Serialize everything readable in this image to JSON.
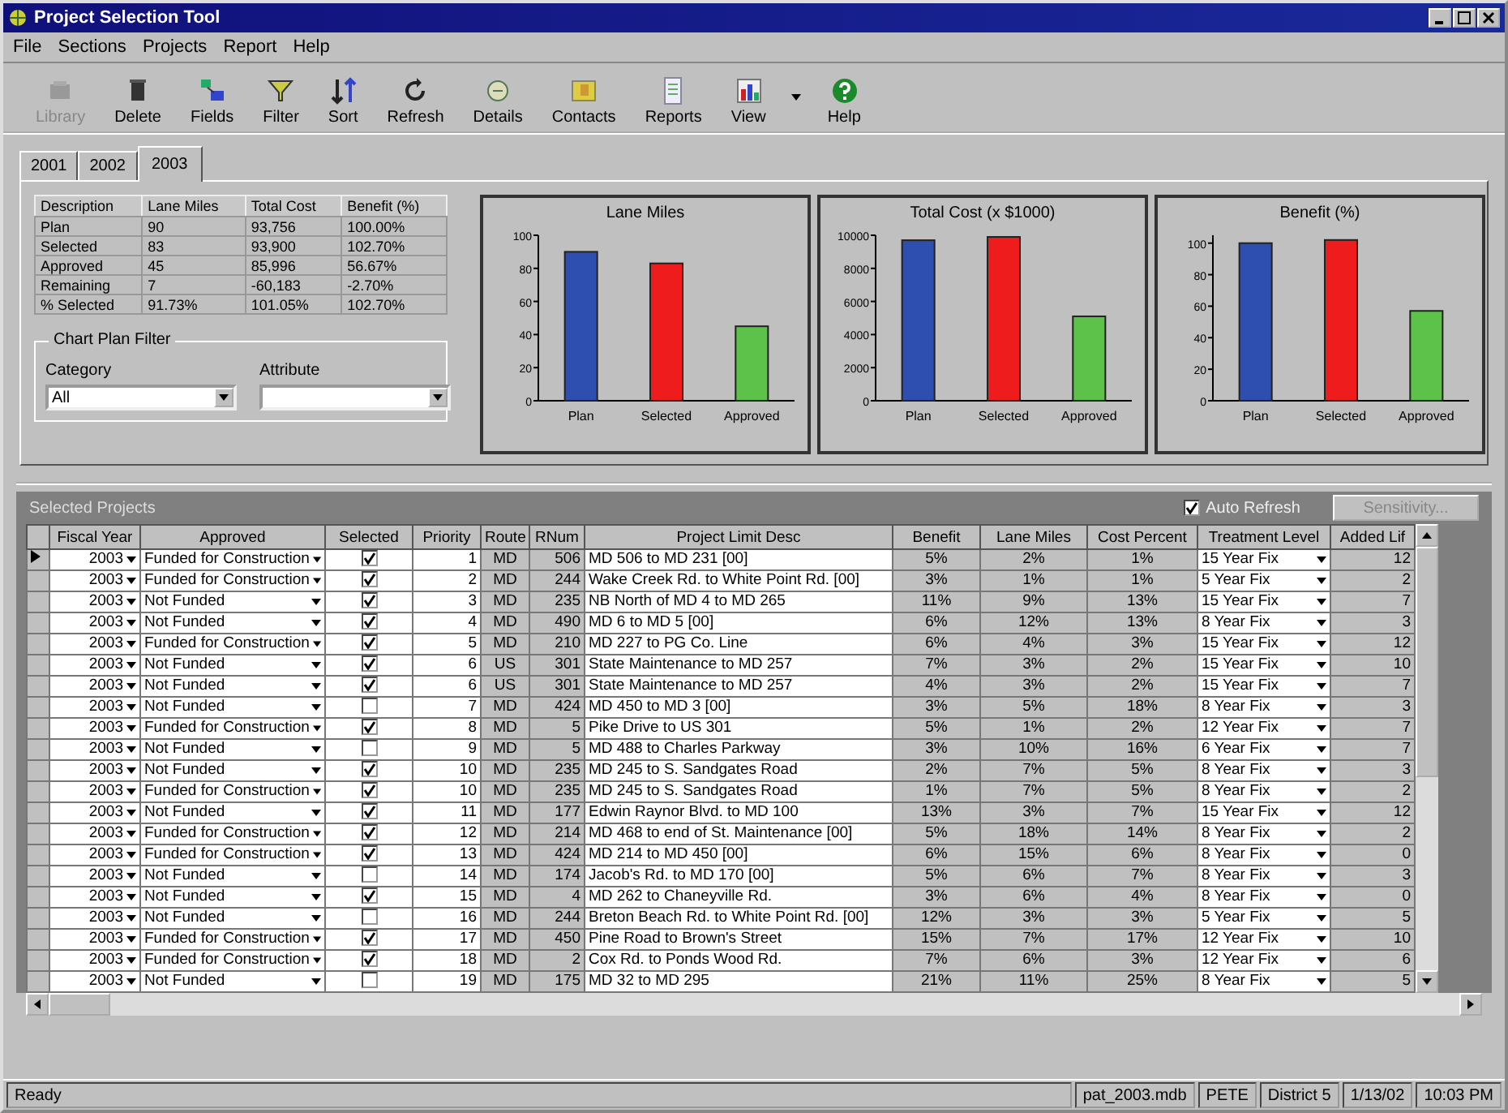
{
  "window": {
    "title": "Project Selection Tool"
  },
  "menu": [
    "File",
    "Sections",
    "Projects",
    "Report",
    "Help"
  ],
  "toolbar": [
    {
      "label": "Library",
      "kind": "library",
      "disabled": true
    },
    {
      "label": "Delete",
      "kind": "delete",
      "disabled": false
    },
    {
      "label": "Fields",
      "kind": "fields",
      "disabled": false
    },
    {
      "label": "Filter",
      "kind": "filter",
      "disabled": false
    },
    {
      "label": "Sort",
      "kind": "sort",
      "disabled": false
    },
    {
      "label": "Refresh",
      "kind": "refresh",
      "disabled": false
    },
    {
      "label": "Details",
      "kind": "details",
      "disabled": false
    },
    {
      "label": "Contacts",
      "kind": "contacts",
      "disabled": false
    },
    {
      "label": "Reports",
      "kind": "reports",
      "disabled": false
    },
    {
      "label": "View",
      "kind": "view",
      "disabled": false
    },
    {
      "label": "Help",
      "kind": "help",
      "disabled": false
    }
  ],
  "tabs": [
    {
      "label": "2001",
      "selected": false
    },
    {
      "label": "2002",
      "selected": false
    },
    {
      "label": "2003",
      "selected": true
    }
  ],
  "summary": {
    "columns": [
      "Description",
      "Lane Miles",
      "Total Cost",
      "Benefit (%)"
    ],
    "rows": [
      [
        "Plan",
        "90",
        "93,756",
        "100.00%"
      ],
      [
        "Selected",
        "83",
        "93,900",
        "102.70%"
      ],
      [
        "Approved",
        "45",
        "85,996",
        "56.67%"
      ],
      [
        "Remaining",
        "7",
        "-60,183",
        "-2.70%"
      ],
      [
        "% Selected",
        "91.73%",
        "101.05%",
        "102.70%"
      ]
    ]
  },
  "chart_plan_filter": {
    "title": "Chart Plan Filter",
    "category": {
      "label": "Category",
      "value": "All"
    },
    "attribute": {
      "label": "Attribute"
    }
  },
  "charts": [
    {
      "chart_data": {
        "type": "bar",
        "title": "Lane Miles",
        "categories": [
          "Plan",
          "Selected",
          "Approved"
        ],
        "colors": [
          "#2f4fb0",
          "#ee1c1c",
          "#5cc24a"
        ],
        "values": [
          90,
          83,
          45
        ],
        "ylim": [
          0,
          100
        ],
        "yticks": [
          0,
          20,
          40,
          60,
          80,
          100
        ]
      }
    },
    {
      "chart_data": {
        "type": "bar",
        "title": "Total Cost (x $1000)",
        "categories": [
          "Plan",
          "Selected",
          "Approved"
        ],
        "colors": [
          "#2f4fb0",
          "#ee1c1c",
          "#5cc24a"
        ],
        "values": [
          9700,
          9900,
          5100
        ],
        "ylim": [
          0,
          10000
        ],
        "yticks": [
          0,
          2000,
          4000,
          6000,
          8000,
          10000
        ]
      }
    },
    {
      "chart_data": {
        "type": "bar",
        "title": "Benefit (%)",
        "categories": [
          "Plan",
          "Selected",
          "Approved"
        ],
        "colors": [
          "#2f4fb0",
          "#ee1c1c",
          "#5cc24a"
        ],
        "values": [
          100,
          102,
          57
        ],
        "ylim": [
          0,
          105
        ],
        "yticks": [
          0,
          20,
          40,
          60,
          80,
          100
        ]
      }
    }
  ],
  "grid": {
    "title": "Selected Projects",
    "auto_refresh": {
      "label": "Auto Refresh",
      "checked": true
    },
    "sensitivity_button": {
      "label": "Sensitivity...",
      "disabled": true
    },
    "columns": [
      "Fiscal Year",
      "Approved",
      "Selected",
      "Priority",
      "Route",
      "RNum",
      "Project Limit Desc",
      "Benefit",
      "Lane Miles",
      "Cost Percent",
      "Treatment Level",
      "Added Lif"
    ],
    "rows": [
      {
        "current": true,
        "year": "2003",
        "approved": "Funded for Construction",
        "checked": true,
        "priority": "1",
        "route": "MD",
        "rnum": "506",
        "desc": "MD 506 to MD 231 [00]",
        "benefit": "5%",
        "lane_miles": "2%",
        "cost_percent": "1%",
        "treatment": "15 Year Fix",
        "added_life": "12"
      },
      {
        "current": false,
        "year": "2003",
        "approved": "Funded for Construction",
        "checked": true,
        "priority": "2",
        "route": "MD",
        "rnum": "244",
        "desc": "Wake Creek Rd. to White Point Rd. [00]",
        "benefit": "3%",
        "lane_miles": "1%",
        "cost_percent": "1%",
        "treatment": "5 Year Fix",
        "added_life": "2"
      },
      {
        "current": false,
        "year": "2003",
        "approved": "Not Funded",
        "checked": true,
        "priority": "3",
        "route": "MD",
        "rnum": "235",
        "desc": "NB North of MD 4 to MD 265",
        "benefit": "11%",
        "lane_miles": "9%",
        "cost_percent": "13%",
        "treatment": "15 Year Fix",
        "added_life": "7"
      },
      {
        "current": false,
        "year": "2003",
        "approved": "Not Funded",
        "checked": true,
        "priority": "4",
        "route": "MD",
        "rnum": "490",
        "desc": "MD 6 to MD 5 [00]",
        "benefit": "6%",
        "lane_miles": "12%",
        "cost_percent": "13%",
        "treatment": "8 Year Fix",
        "added_life": "3"
      },
      {
        "current": false,
        "year": "2003",
        "approved": "Funded for Construction",
        "checked": true,
        "priority": "5",
        "route": "MD",
        "rnum": "210",
        "desc": "MD 227 to PG Co. Line",
        "benefit": "6%",
        "lane_miles": "4%",
        "cost_percent": "3%",
        "treatment": "15 Year Fix",
        "added_life": "12"
      },
      {
        "current": false,
        "year": "2003",
        "approved": "Not Funded",
        "checked": true,
        "priority": "6",
        "route": "US",
        "rnum": "301",
        "desc": "State Maintenance to MD 257",
        "benefit": "7%",
        "lane_miles": "3%",
        "cost_percent": "2%",
        "treatment": "15 Year Fix",
        "added_life": "10"
      },
      {
        "current": false,
        "year": "2003",
        "approved": "Not Funded",
        "checked": true,
        "priority": "6",
        "route": "US",
        "rnum": "301",
        "desc": "State Maintenance to MD 257",
        "benefit": "4%",
        "lane_miles": "3%",
        "cost_percent": "2%",
        "treatment": "15 Year Fix",
        "added_life": "7"
      },
      {
        "current": false,
        "year": "2003",
        "approved": "Not Funded",
        "checked": false,
        "priority": "7",
        "route": "MD",
        "rnum": "424",
        "desc": "MD 450 to MD 3 [00]",
        "benefit": "3%",
        "lane_miles": "5%",
        "cost_percent": "18%",
        "treatment": "8 Year Fix",
        "added_life": "3"
      },
      {
        "current": false,
        "year": "2003",
        "approved": "Funded for Construction",
        "checked": true,
        "priority": "8",
        "route": "MD",
        "rnum": "5",
        "desc": "Pike Drive to US 301",
        "benefit": "5%",
        "lane_miles": "1%",
        "cost_percent": "2%",
        "treatment": "12 Year Fix",
        "added_life": "7"
      },
      {
        "current": false,
        "year": "2003",
        "approved": "Not Funded",
        "checked": false,
        "priority": "9",
        "route": "MD",
        "rnum": "5",
        "desc": "MD 488 to Charles Parkway",
        "benefit": "3%",
        "lane_miles": "10%",
        "cost_percent": "16%",
        "treatment": "6 Year Fix",
        "added_life": "7"
      },
      {
        "current": false,
        "year": "2003",
        "approved": "Not Funded",
        "checked": true,
        "priority": "10",
        "route": "MD",
        "rnum": "235",
        "desc": "MD 245 to S. Sandgates Road",
        "benefit": "2%",
        "lane_miles": "7%",
        "cost_percent": "5%",
        "treatment": "8 Year Fix",
        "added_life": "3"
      },
      {
        "current": false,
        "year": "2003",
        "approved": "Funded for Construction",
        "checked": true,
        "priority": "10",
        "route": "MD",
        "rnum": "235",
        "desc": "MD 245 to S. Sandgates Road",
        "benefit": "1%",
        "lane_miles": "7%",
        "cost_percent": "5%",
        "treatment": "8 Year Fix",
        "added_life": "2"
      },
      {
        "current": false,
        "year": "2003",
        "approved": "Not Funded",
        "checked": true,
        "priority": "11",
        "route": "MD",
        "rnum": "177",
        "desc": "Edwin Raynor Blvd. to MD 100",
        "benefit": "13%",
        "lane_miles": "3%",
        "cost_percent": "7%",
        "treatment": "15 Year Fix",
        "added_life": "12"
      },
      {
        "current": false,
        "year": "2003",
        "approved": "Funded for Construction",
        "checked": true,
        "priority": "12",
        "route": "MD",
        "rnum": "214",
        "desc": "MD 468 to end of St. Maintenance [00]",
        "benefit": "5%",
        "lane_miles": "18%",
        "cost_percent": "14%",
        "treatment": "8 Year Fix",
        "added_life": "2"
      },
      {
        "current": false,
        "year": "2003",
        "approved": "Funded for Construction",
        "checked": true,
        "priority": "13",
        "route": "MD",
        "rnum": "424",
        "desc": "MD 214 to MD 450 [00]",
        "benefit": "6%",
        "lane_miles": "15%",
        "cost_percent": "6%",
        "treatment": "8 Year Fix",
        "added_life": "0"
      },
      {
        "current": false,
        "year": "2003",
        "approved": "Not Funded",
        "checked": false,
        "priority": "14",
        "route": "MD",
        "rnum": "174",
        "desc": "Jacob's Rd. to MD 170 [00]",
        "benefit": "5%",
        "lane_miles": "6%",
        "cost_percent": "7%",
        "treatment": "8 Year Fix",
        "added_life": "3"
      },
      {
        "current": false,
        "year": "2003",
        "approved": "Not Funded",
        "checked": true,
        "priority": "15",
        "route": "MD",
        "rnum": "4",
        "desc": "MD 262 to Chaneyville Rd.",
        "benefit": "3%",
        "lane_miles": "6%",
        "cost_percent": "4%",
        "treatment": "8 Year Fix",
        "added_life": "0"
      },
      {
        "current": false,
        "year": "2003",
        "approved": "Not Funded",
        "checked": false,
        "priority": "16",
        "route": "MD",
        "rnum": "244",
        "desc": "Breton Beach Rd. to White Point Rd. [00]",
        "benefit": "12%",
        "lane_miles": "3%",
        "cost_percent": "3%",
        "treatment": "5 Year Fix",
        "added_life": "5"
      },
      {
        "current": false,
        "year": "2003",
        "approved": "Funded for Construction",
        "checked": true,
        "priority": "17",
        "route": "MD",
        "rnum": "450",
        "desc": "Pine Road to Brown's Street",
        "benefit": "15%",
        "lane_miles": "7%",
        "cost_percent": "17%",
        "treatment": "12 Year Fix",
        "added_life": "10"
      },
      {
        "current": false,
        "year": "2003",
        "approved": "Funded for Construction",
        "checked": true,
        "priority": "18",
        "route": "MD",
        "rnum": "2",
        "desc": "Cox Rd. to Ponds Wood Rd.",
        "benefit": "7%",
        "lane_miles": "6%",
        "cost_percent": "3%",
        "treatment": "12 Year Fix",
        "added_life": "6"
      },
      {
        "current": false,
        "year": "2003",
        "approved": "Not Funded",
        "checked": false,
        "priority": "19",
        "route": "MD",
        "rnum": "175",
        "desc": "MD 32 to MD 295",
        "benefit": "21%",
        "lane_miles": "11%",
        "cost_percent": "25%",
        "treatment": "8 Year Fix",
        "added_life": "5"
      }
    ]
  },
  "status_bar": [
    "Ready",
    "pat_2003.mdb",
    "PETE",
    "District 5",
    "1/13/02",
    "10:03 PM"
  ]
}
